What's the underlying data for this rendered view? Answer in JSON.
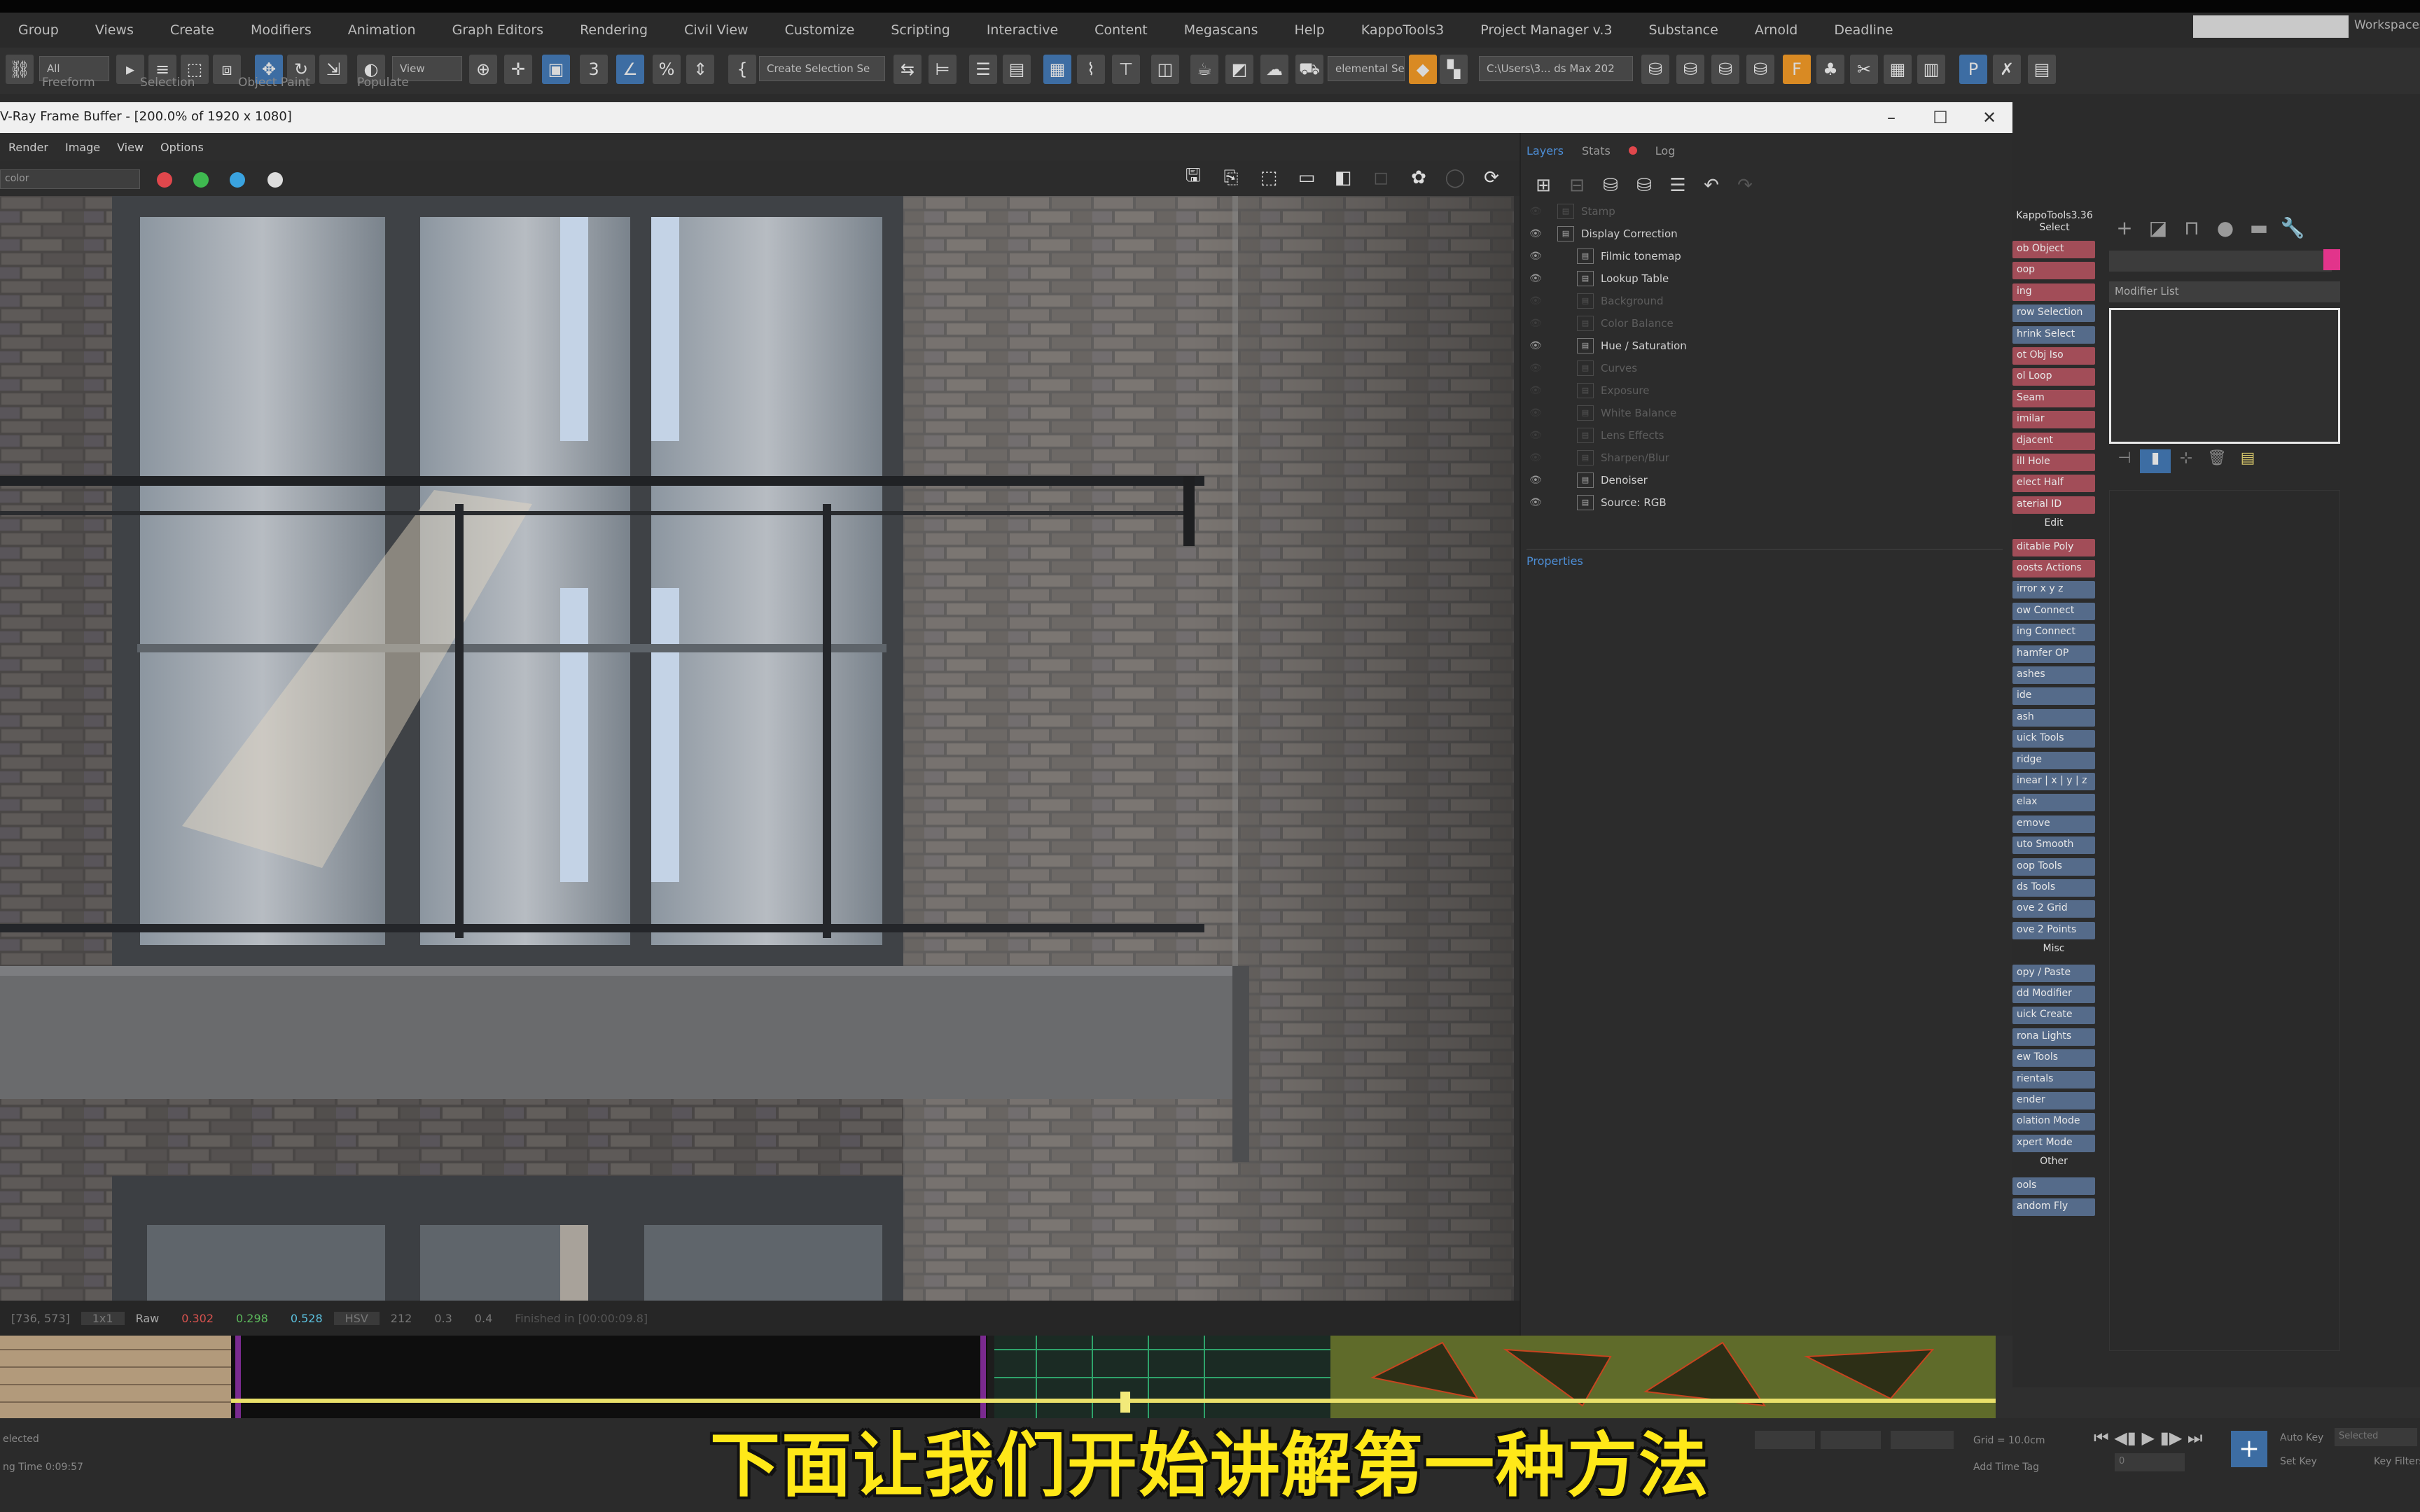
{
  "menubar": [
    "Group",
    "Views",
    "Create",
    "Modifiers",
    "Animation",
    "Graph Editors",
    "Rendering",
    "Civil View",
    "Customize",
    "Scripting",
    "Interactive",
    "Content",
    "Megascans",
    "Help",
    "KappoTools3",
    "Project Manager v.3",
    "Substance",
    "Arnold",
    "Deadline"
  ],
  "workspace_label": "Workspaces",
  "toolbar": {
    "filter_all": "All",
    "view_dropdown": "View",
    "selection_set": "Create Selection Se",
    "named_set": "elemental Set",
    "path_field": "C:\\Users\\3... ds Max 202"
  },
  "ribbon_tabs": [
    "Freeform",
    "Selection",
    "Object Paint",
    "Populate"
  ],
  "vfb": {
    "title": "V-Ray Frame Buffer - [200.0% of 1920 x 1080]",
    "menus": [
      "Render",
      "Image",
      "View",
      "Options"
    ],
    "channel": "color",
    "window_min": "–",
    "window_max": "☐",
    "window_close": "✕",
    "status": {
      "coords": "[736, 573]",
      "zoom": "1x1",
      "mode": "Raw",
      "r": "0.302",
      "g": "0.298",
      "b": "0.528",
      "space": "HSV",
      "h": "212",
      "s": "0.3",
      "v": "0.4",
      "info": "Finished in [00:00:09.8]"
    }
  },
  "layers_panel": {
    "tabs": [
      "Layers",
      "Stats",
      "Log"
    ],
    "items": [
      {
        "label": "Stamp",
        "state": "off",
        "indent": 0,
        "eye": false
      },
      {
        "label": "Display Correction",
        "state": "on",
        "indent": 0,
        "eye": true
      },
      {
        "label": "Filmic tonemap",
        "state": "on",
        "indent": 1,
        "eye": true
      },
      {
        "label": "Lookup Table",
        "state": "on",
        "indent": 1,
        "eye": true
      },
      {
        "label": "Background",
        "state": "off",
        "indent": 1,
        "eye": false
      },
      {
        "label": "Color Balance",
        "state": "off",
        "indent": 1,
        "eye": false
      },
      {
        "label": "Hue / Saturation",
        "state": "on",
        "indent": 1,
        "eye": true
      },
      {
        "label": "Curves",
        "state": "off",
        "indent": 1,
        "eye": false
      },
      {
        "label": "Exposure",
        "state": "off",
        "indent": 1,
        "eye": false
      },
      {
        "label": "White Balance",
        "state": "off",
        "indent": 1,
        "eye": false
      },
      {
        "label": "Lens Effects",
        "state": "off",
        "indent": 1,
        "eye": false
      },
      {
        "label": "Sharpen/Blur",
        "state": "off",
        "indent": 1,
        "eye": false
      },
      {
        "label": "Denoiser",
        "state": "on",
        "indent": 1,
        "eye": true
      },
      {
        "label": "Source: RGB",
        "state": "on",
        "indent": 1,
        "eye": true
      }
    ],
    "properties_label": "Properties"
  },
  "kappo_panel": {
    "title": "KappoTools3.36",
    "subtitle": "Select",
    "buttons": [
      {
        "label": "ob Object",
        "color": "red"
      },
      {
        "label": "oop",
        "color": "red"
      },
      {
        "label": "ing",
        "color": "red"
      },
      {
        "label": "row Selection",
        "color": "blue"
      },
      {
        "label": "hrink Select",
        "color": "blue"
      },
      {
        "label": "ot Obj Iso",
        "color": "red"
      },
      {
        "label": "ol Loop",
        "color": "red"
      },
      {
        "label": "Seam",
        "color": "red"
      },
      {
        "label": "imilar",
        "color": "red"
      },
      {
        "label": "djacent",
        "color": "red"
      },
      {
        "label": "ill Hole",
        "color": "red"
      },
      {
        "label": "elect Half",
        "color": "red"
      },
      {
        "label": "aterial ID",
        "color": "red"
      },
      {
        "section": "Edit"
      },
      {
        "label": "ditable Poly",
        "color": "red"
      },
      {
        "label": "oosts Actions",
        "color": "red"
      },
      {
        "label": "irror  x  y  z",
        "color": "blue"
      },
      {
        "label": "ow Connect",
        "color": "blue"
      },
      {
        "label": "ing Connect",
        "color": "blue"
      },
      {
        "label": "hamfer OP",
        "color": "blue"
      },
      {
        "label": "ashes",
        "color": "blue"
      },
      {
        "label": "ide",
        "color": "blue"
      },
      {
        "label": "ash",
        "color": "blue"
      },
      {
        "label": "uick Tools",
        "color": "blue"
      },
      {
        "label": "ridge",
        "color": "blue"
      },
      {
        "label": "inear | x | y | z",
        "color": "blue"
      },
      {
        "label": "elax",
        "color": "blue"
      },
      {
        "label": "emove",
        "color": "blue"
      },
      {
        "label": "uto Smooth",
        "color": "blue"
      },
      {
        "label": "oop Tools",
        "color": "blue"
      },
      {
        "label": "ds Tools",
        "color": "blue"
      },
      {
        "label": "ove 2 Grid",
        "color": "blue"
      },
      {
        "label": "ove 2 Points",
        "color": "blue"
      },
      {
        "section": "Misc"
      },
      {
        "label": "opy / Paste",
        "color": "blue"
      },
      {
        "label": "dd Modifier",
        "color": "blue"
      },
      {
        "label": "uick Create",
        "color": "blue"
      },
      {
        "label": "rona Lights",
        "color": "blue"
      },
      {
        "label": "ew Tools",
        "color": "blue"
      },
      {
        "label": "rientals",
        "color": "blue"
      },
      {
        "label": "ender",
        "color": "blue"
      },
      {
        "label": "olation Mode",
        "color": "blue"
      },
      {
        "label": "xpert Mode",
        "color": "blue"
      },
      {
        "section": "Other"
      },
      {
        "label": "ools",
        "color": "blue"
      },
      {
        "label": "andom Fly",
        "color": "blue"
      }
    ]
  },
  "command_panel": {
    "modifier_list": "Modifier List",
    "name_color": "#e2348b"
  },
  "statusbar": {
    "selected": "elected",
    "render_time": "ng Time  0:09:57",
    "grid": "Grid = 10.0cm",
    "add_time_tag": "Add Time Tag",
    "auto_key": "Auto Key",
    "set_key": "Set Key",
    "selected_dropdown": "Selected",
    "key_filters": "Key Filters...",
    "frame": "0"
  },
  "subtitle": "下面让我们开始讲解第一种方法"
}
